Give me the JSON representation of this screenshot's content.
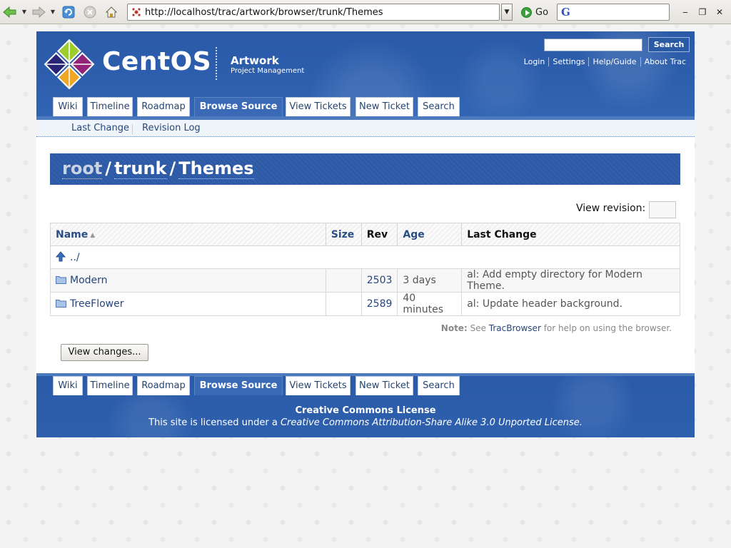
{
  "browser": {
    "url": "http://localhost/trac/artwork/browser/trunk/Themes",
    "go_label": "Go"
  },
  "header": {
    "logo_text": "CentOS",
    "project_name": "Artwork",
    "project_subtitle": "Project Management",
    "search_button": "Search",
    "metanav": [
      "Login",
      "Settings",
      "Help/Guide",
      "About Trac"
    ]
  },
  "mainnav": {
    "tabs": [
      "Wiki",
      "Timeline",
      "Roadmap",
      "Browse Source",
      "View Tickets",
      "New Ticket",
      "Search"
    ],
    "active": "Browse Source"
  },
  "ctxtnav": {
    "last_change": "Last Change",
    "revision_log": "Revision Log"
  },
  "breadcrumb": {
    "root": "root",
    "trunk": "trunk",
    "current": "Themes"
  },
  "view_revision_label": "View revision:",
  "table": {
    "headers": {
      "name": "Name",
      "size": "Size",
      "rev": "Rev",
      "age": "Age",
      "last_change": "Last Change"
    },
    "parent_link": "../",
    "rows": [
      {
        "name": "Modern",
        "size": "",
        "rev": "2503",
        "age": "3 days",
        "change": "al: Add empty directory for Modern Theme."
      },
      {
        "name": "TreeFlower",
        "size": "",
        "rev": "2589",
        "age": "40 minutes",
        "change": "al: Update header background."
      }
    ]
  },
  "note": {
    "label": "Note:",
    "pre": "See",
    "link": "TracBrowser",
    "post": "for help on using the browser."
  },
  "view_changes_button": "View changes...",
  "footer": {
    "license_title": "Creative Commons License",
    "license_pre": "This site is licensed under a",
    "license_name": "Creative Commons Attribution-Share Alike 3.0 Unported License."
  }
}
